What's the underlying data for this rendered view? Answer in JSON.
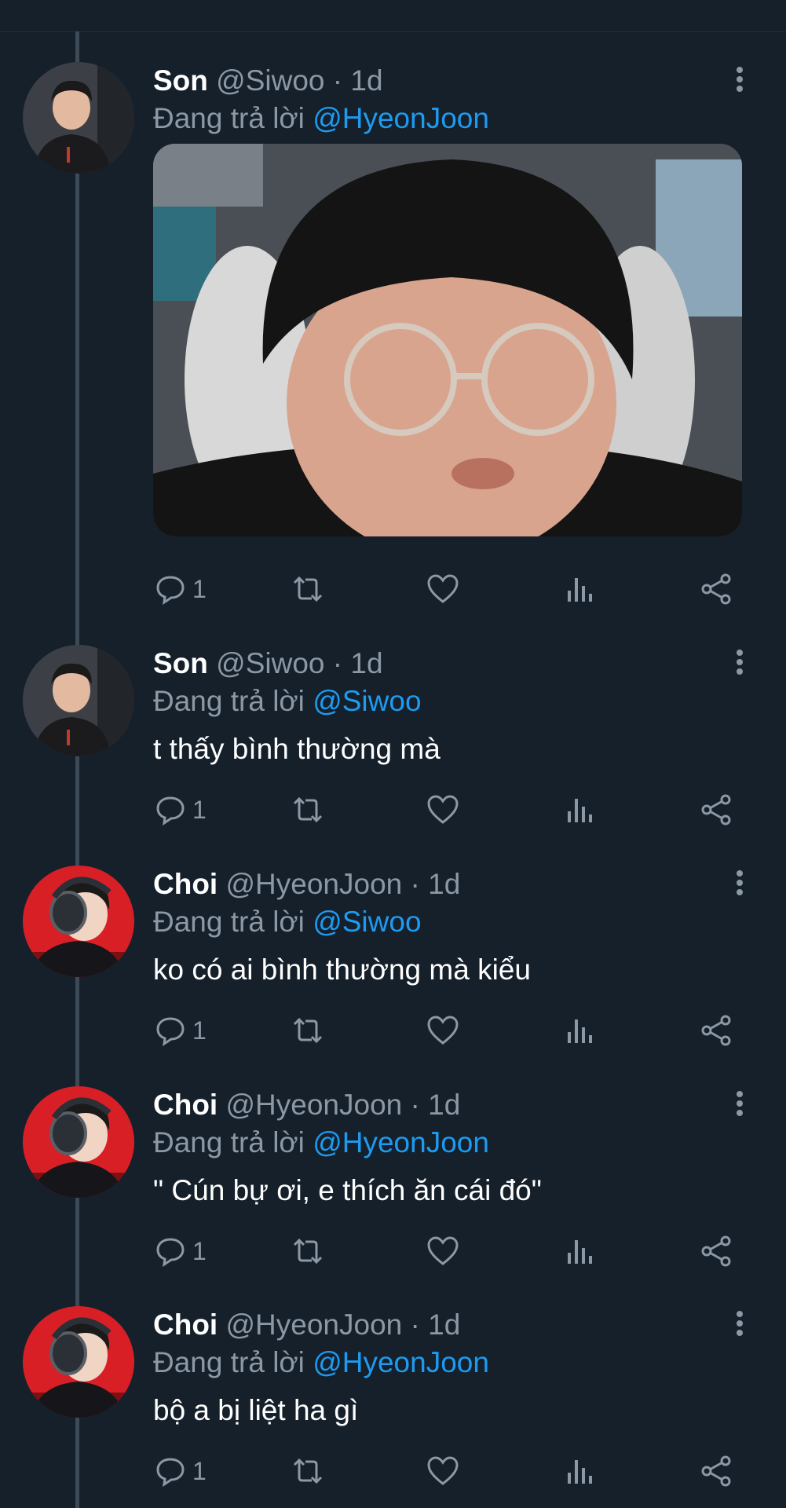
{
  "labels": {
    "replying_to": "Đang trả lời",
    "separator": "·"
  },
  "colors": {
    "background": "#15202b",
    "muted": "#8b98a5",
    "accent": "#1d9bf0",
    "thread_line": "#3d4a57"
  },
  "action_icons": [
    "reply-icon",
    "retweet-icon",
    "like-icon",
    "views-icon",
    "share-icon"
  ],
  "tweets": [
    {
      "name": "Son",
      "handle": "@Siwoo",
      "time": "1d",
      "reply_to": "@HyeonJoon",
      "text": "",
      "has_media": true,
      "reply_count": "1"
    },
    {
      "name": "Son",
      "handle": "@Siwoo",
      "time": "1d",
      "reply_to": "@Siwoo",
      "text": "t thấy bình thường mà",
      "has_media": false,
      "reply_count": "1"
    },
    {
      "name": "Choi",
      "handle": "@HyeonJoon",
      "time": "1d",
      "reply_to": "@Siwoo",
      "text": "ko có ai bình thường mà kiểu",
      "has_media": false,
      "reply_count": "1"
    },
    {
      "name": "Choi",
      "handle": "@HyeonJoon",
      "time": "1d",
      "reply_to": "@HyeonJoon",
      "text": "\" Cún bự ơi, e thích ăn cái đó\"",
      "has_media": false,
      "reply_count": "1"
    },
    {
      "name": "Choi",
      "handle": "@HyeonJoon",
      "time": "1d",
      "reply_to": "@HyeonJoon",
      "text": "bộ a bị liệt ha gì",
      "has_media": false,
      "reply_count": "1"
    }
  ]
}
